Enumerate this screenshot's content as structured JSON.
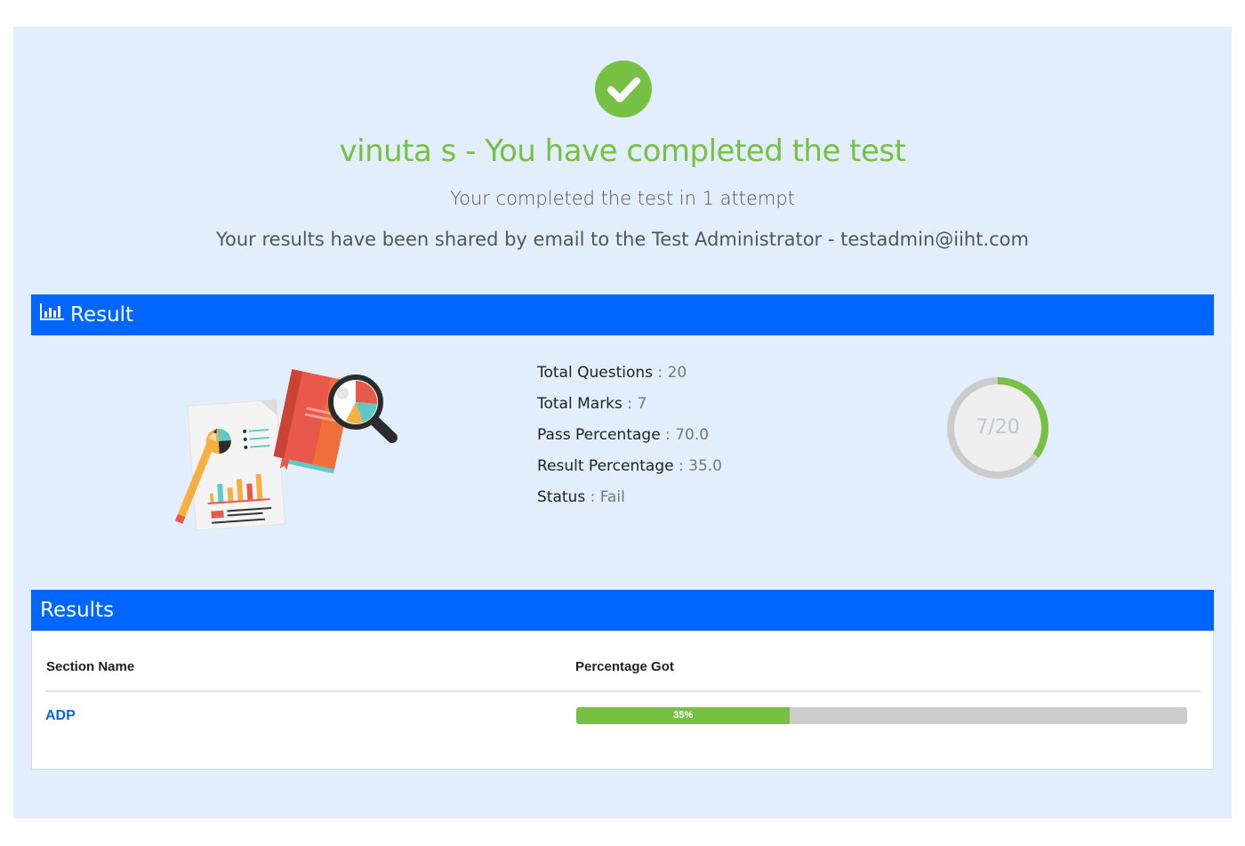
{
  "header": {
    "title": "vinuta s - You have completed the test",
    "attempt_text": "Your completed the test in 1 attempt",
    "shared_text": "Your results have been shared by email to the Test Administrator - testadmin@iiht.com"
  },
  "result_section": {
    "heading": "Result",
    "stats": [
      {
        "label": "Total Questions",
        "sep": " : ",
        "value": "20"
      },
      {
        "label": "Total Marks",
        "sep": " : ",
        "value": "7"
      },
      {
        "label": "Pass Percentage",
        "sep": " : ",
        "value": "70.0"
      },
      {
        "label": "Result Percentage",
        "sep": " : ",
        "value": "35.0"
      },
      {
        "label": "Status",
        "sep": " : ",
        "value": "Fail"
      }
    ],
    "score_label": "7/20",
    "score_fraction": 0.35
  },
  "results_table": {
    "heading": "Results",
    "columns": [
      "Section Name",
      "Percentage Got"
    ],
    "rows": [
      {
        "section": "ADP",
        "percent": 35,
        "percent_label": "35%"
      }
    ]
  },
  "colors": {
    "accent_green": "#76c043",
    "header_blue": "#0066ff",
    "link_blue": "#0a66e0",
    "panel_bg": "#e3eefc"
  },
  "icons": {
    "success": "check-circle-icon",
    "result": "bar-chart-icon"
  }
}
